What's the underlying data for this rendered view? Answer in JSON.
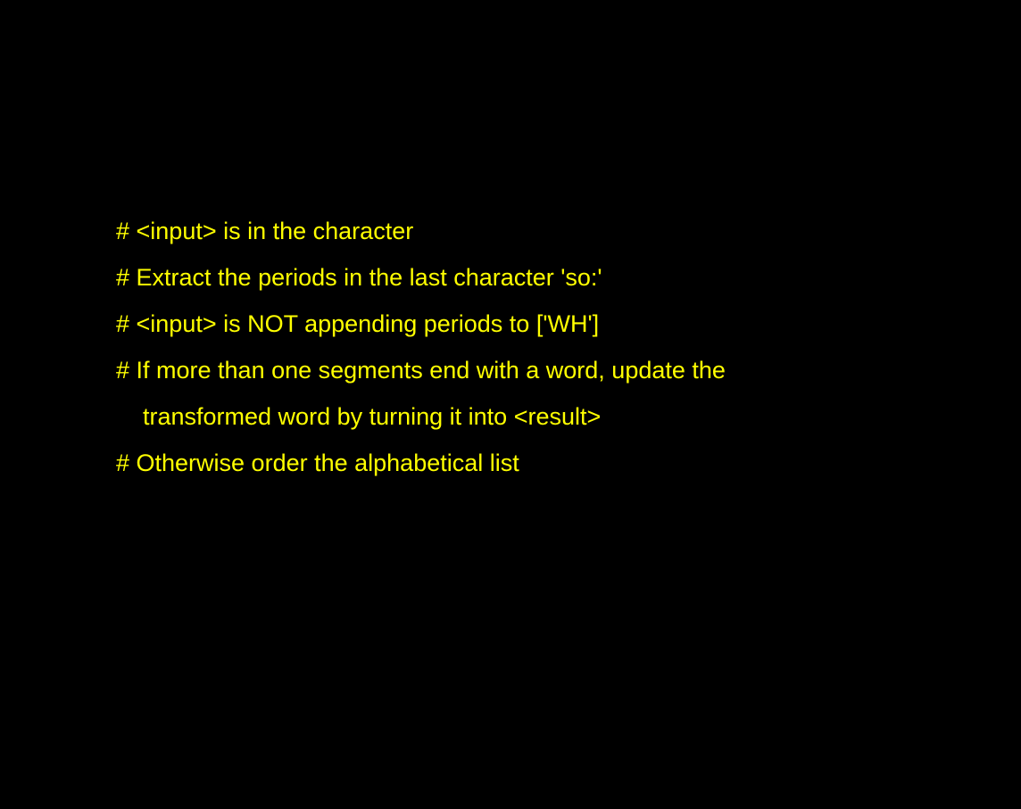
{
  "text_color": "#FFFF00",
  "background_color": "#000000",
  "lines": [
    {
      "text": "# <input> is in the character"
    },
    {
      "text": "# Extract the periods in the last character 'so:'"
    },
    {
      "text": "# <input> is NOT appending periods to ['WH']"
    },
    {
      "text": "# If more than one segments end with a word, update the"
    },
    {
      "text": "transformed word by turning it into <result>"
    },
    {
      "text": "# Otherwise order the alphabetical list"
    }
  ]
}
